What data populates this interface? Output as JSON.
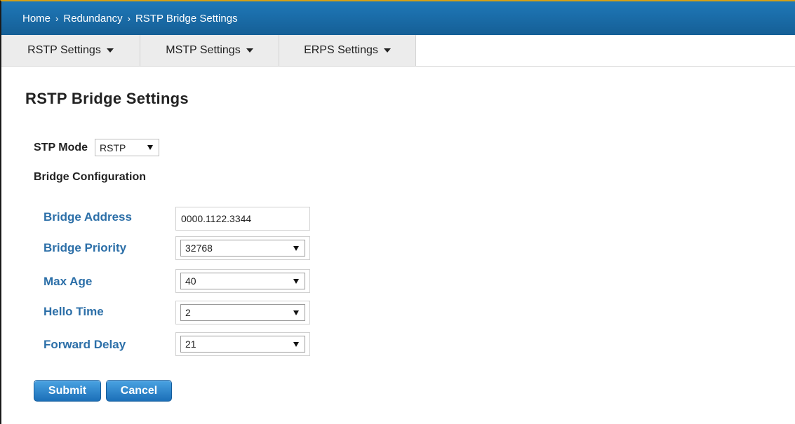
{
  "breadcrumb": {
    "items": [
      "Home",
      "Redundancy",
      "RSTP Bridge Settings"
    ],
    "separator": "›"
  },
  "tabs": [
    {
      "label": "RSTP Settings"
    },
    {
      "label": "MSTP Settings"
    },
    {
      "label": "ERPS Settings"
    }
  ],
  "page": {
    "title": "RSTP Bridge Settings"
  },
  "stp_mode": {
    "label": "STP Mode",
    "value": "RSTP"
  },
  "bridge_config": {
    "title": "Bridge Configuration",
    "address_label": "Bridge Address",
    "address_value": "0000.1122.3344",
    "priority_label": "Bridge Priority",
    "priority_value": "32768",
    "max_age_label": "Max Age",
    "max_age_value": "40",
    "hello_time_label": "Hello Time",
    "hello_time_value": "2",
    "forward_delay_label": "Forward Delay",
    "forward_delay_value": "21"
  },
  "buttons": {
    "submit": "Submit",
    "cancel": "Cancel"
  },
  "colors": {
    "header_blue": "#1a6ca8",
    "label_blue": "#2c6fa8",
    "button_blue": "#2a85cc"
  }
}
